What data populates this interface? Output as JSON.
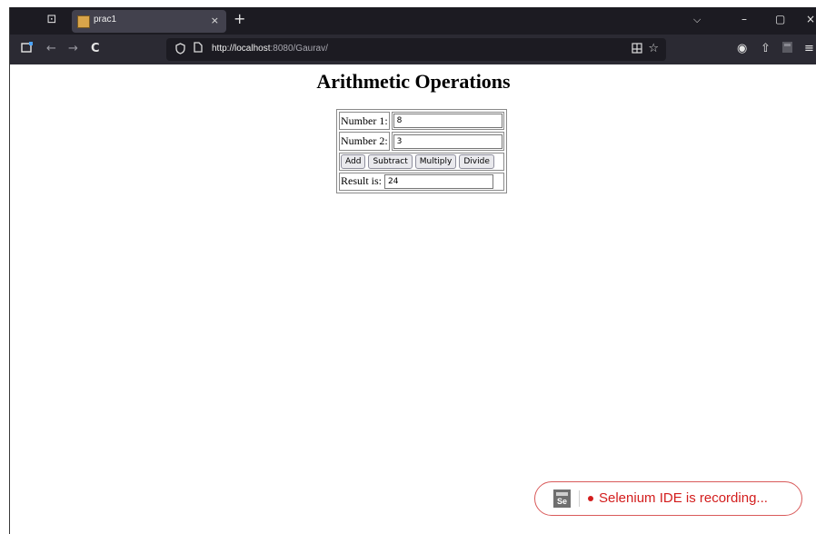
{
  "browser": {
    "tab": {
      "title": "prac1",
      "close": "×"
    },
    "new_tab": "+",
    "list_tabs_icon": "⊡",
    "chevron": "⌵",
    "window_controls": {
      "minimize": "–",
      "maximize": "▢",
      "close": "×"
    },
    "nav": {
      "back": "←",
      "forward": "→",
      "reload": "C"
    },
    "url": {
      "host": "http://localhost",
      "rest": ":8080/Gaurav/"
    },
    "toolbar_icons": {
      "account": "◉",
      "extensions": "⇧",
      "menu": "≡"
    }
  },
  "page": {
    "heading": "Arithmetic Operations",
    "form": {
      "number1_label": "Number 1:",
      "number1_value": "8",
      "number2_label": "Number 2:",
      "number2_value": "3",
      "buttons": {
        "add": "Add",
        "subtract": "Subtract",
        "multiply": "Multiply",
        "divide": "Divide"
      },
      "result_label": "Result is:",
      "result_value": "24"
    }
  },
  "selenium": {
    "logo": "Se",
    "status": "Selenium IDE is recording..."
  },
  "colors": {
    "tab_bar": "#1c1b22",
    "nav_bar": "#2b2a33",
    "recording_red": "#d31d1d"
  }
}
